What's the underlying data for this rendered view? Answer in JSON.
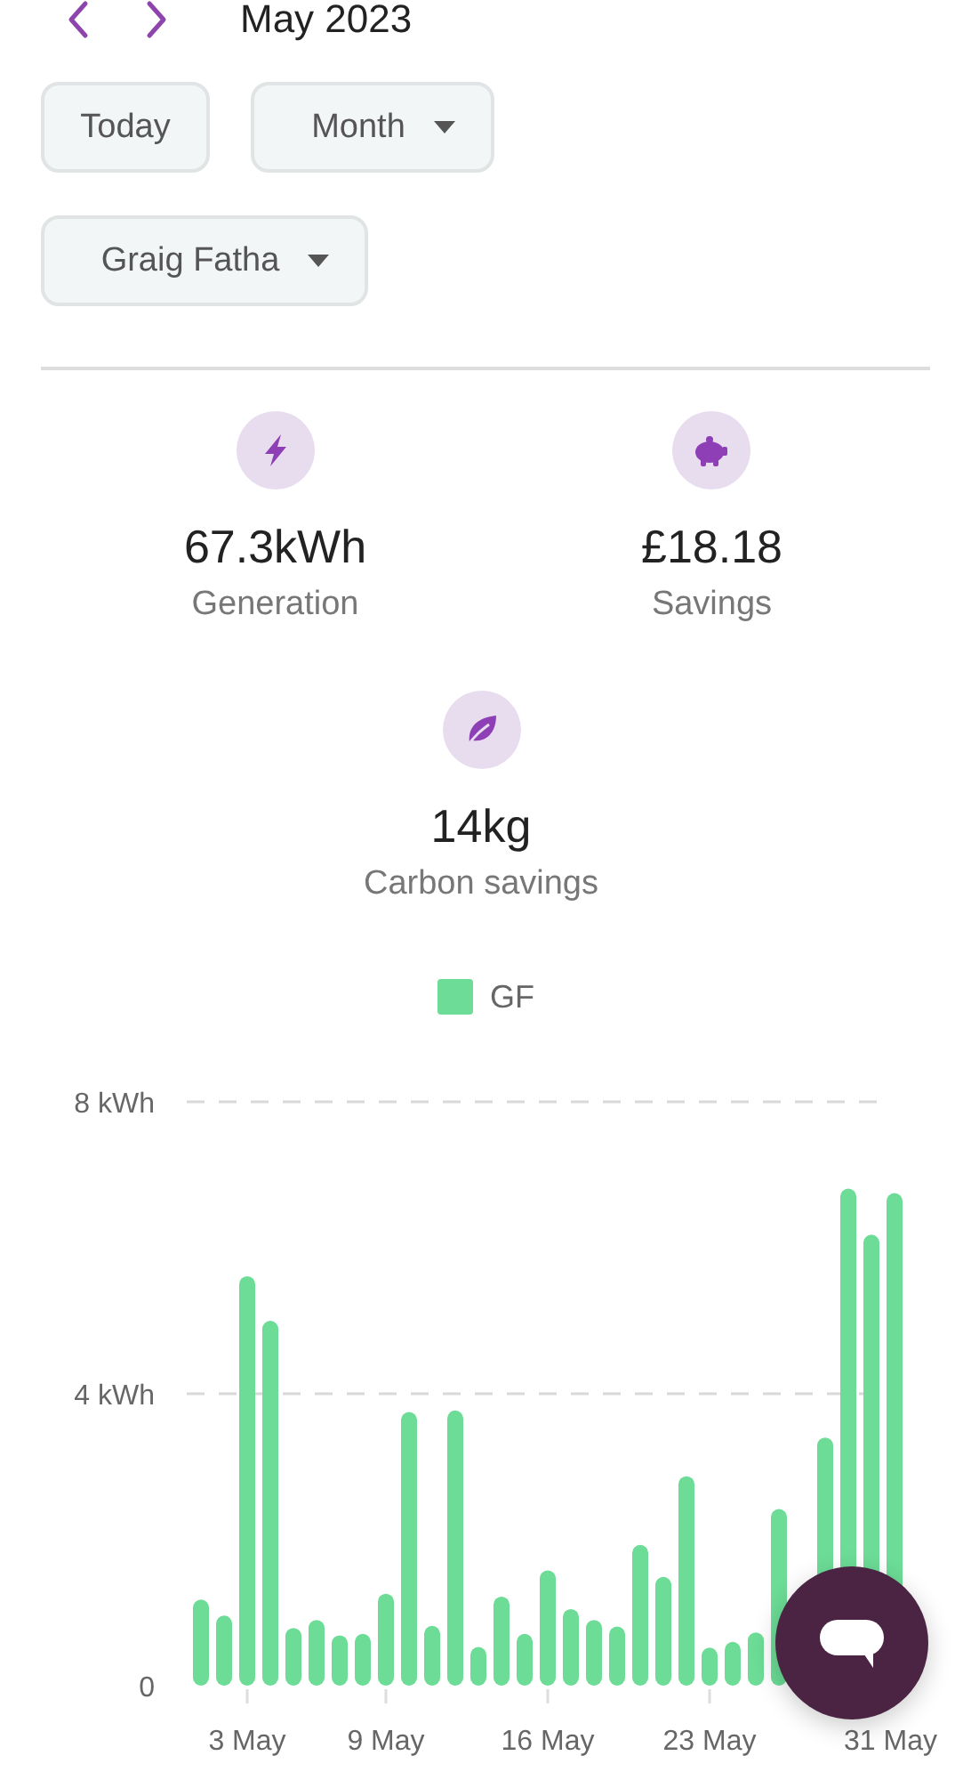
{
  "header": {
    "title": "May 2023"
  },
  "controls": {
    "today": "Today",
    "period": "Month",
    "site": "Graig Fatha"
  },
  "stats": [
    {
      "kind": "generation",
      "value": "67.3kWh",
      "label": "Generation"
    },
    {
      "kind": "savings",
      "value": "£18.18",
      "label": "Savings"
    },
    {
      "kind": "carbon",
      "value": "14kg",
      "label": "Carbon savings"
    }
  ],
  "chart": {
    "chart_data": {
      "type": "bar",
      "categories": [
        null,
        null,
        "3 May",
        null,
        null,
        null,
        null,
        null,
        "9 May",
        null,
        null,
        null,
        null,
        null,
        null,
        "16 May",
        null,
        null,
        null,
        null,
        null,
        null,
        "23 May",
        null,
        null,
        null,
        null,
        null,
        null,
        null,
        "31 May"
      ],
      "series": [
        {
          "name": "GF",
          "color": "#6cdc96",
          "values": [
            1.18,
            0.96,
            5.61,
            5.0,
            0.79,
            0.9,
            0.69,
            0.71,
            1.26,
            3.75,
            0.82,
            3.77,
            0.53,
            1.22,
            0.71,
            1.58,
            1.05,
            0.9,
            0.81,
            1.93,
            1.49,
            2.87,
            0.52,
            0.6,
            0.73,
            2.42,
            null,
            3.4,
            6.81,
            6.18,
            6.75
          ]
        }
      ],
      "ylim": [
        0,
        8
      ],
      "yticks": [
        0,
        {
          "value": 4,
          "label": "4 kWh"
        },
        {
          "value": 8,
          "label": "8 kWh"
        }
      ]
    }
  }
}
